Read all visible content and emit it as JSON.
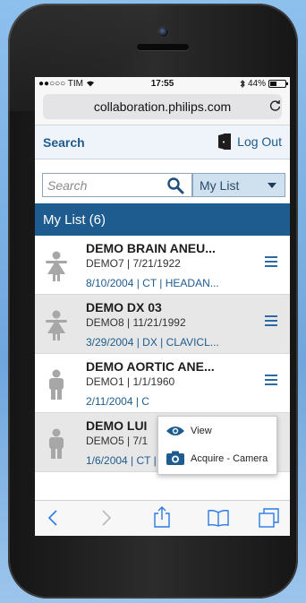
{
  "status": {
    "carrier": "●●○○○ TIM",
    "time": "17:55",
    "battery_label": "44%",
    "battery_level": 0.44
  },
  "browser": {
    "url": "collaboration.philips.com",
    "reload_icon": "reload-icon"
  },
  "appbar": {
    "search_label": "Search",
    "logout_label": "Log Out"
  },
  "filter": {
    "search_placeholder": "Search",
    "list_selected": "My List"
  },
  "list": {
    "header": "My List (6)",
    "rows": [
      {
        "name": "DEMO BRAIN ANEU...",
        "sub": "DEMO7 | 7/21/1922",
        "meta": "8/10/2004 | CT | HEADAN...",
        "gender": "female"
      },
      {
        "name": "DEMO DX 03",
        "sub": "DEMO8 | 11/21/1992",
        "meta": "3/29/2004 | DX | CLAVICL...",
        "gender": "female"
      },
      {
        "name": "DEMO AORTIC ANE...",
        "sub": "DEMO1 | 1/1/1960",
        "meta": "2/11/2004 | C",
        "gender": "male"
      },
      {
        "name": "DEMO LUI",
        "sub": "DEMO5 | 7/1",
        "meta": "1/6/2004 | CT | THX_OBB ...",
        "gender": "male"
      }
    ]
  },
  "popup": {
    "items": [
      {
        "label": "View",
        "icon": "eye-icon"
      },
      {
        "label": "Acquire - Camera",
        "icon": "camera-icon"
      }
    ]
  },
  "toolbar": {
    "icons": [
      "back-icon",
      "forward-icon",
      "share-icon",
      "bookmarks-icon",
      "tabs-icon"
    ]
  },
  "colors": {
    "brand_blue": "#1e5b8f",
    "alt_row": "#e7e7e7",
    "background": "#7fb2e6"
  }
}
